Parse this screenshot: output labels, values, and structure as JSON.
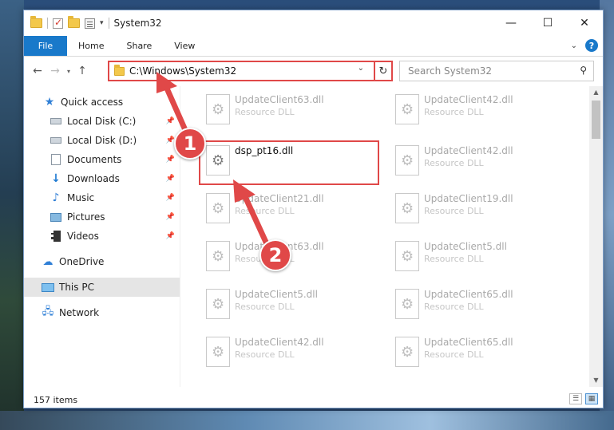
{
  "window": {
    "title": "System32"
  },
  "ribbon": {
    "tabs": [
      "File",
      "Home",
      "Share",
      "View"
    ]
  },
  "address": {
    "path": "C:\\Windows\\System32"
  },
  "search": {
    "placeholder": "Search System32"
  },
  "sidebar": {
    "items": [
      {
        "label": "Quick access",
        "icon": "star-icon"
      },
      {
        "label": "Local Disk (C:)",
        "icon": "drive-icon",
        "pinned": true
      },
      {
        "label": "Local Disk (D:)",
        "icon": "drive-icon",
        "pinned": true
      },
      {
        "label": "Documents",
        "icon": "documents-icon",
        "pinned": true
      },
      {
        "label": "Downloads",
        "icon": "download-icon",
        "pinned": true
      },
      {
        "label": "Music",
        "icon": "music-icon",
        "pinned": true
      },
      {
        "label": "Pictures",
        "icon": "pictures-icon",
        "pinned": true
      },
      {
        "label": "Videos",
        "icon": "videos-icon",
        "pinned": true
      },
      {
        "label": "OneDrive",
        "icon": "cloud-icon"
      },
      {
        "label": "This PC",
        "icon": "computer-icon",
        "selected": true
      },
      {
        "label": "Network",
        "icon": "network-icon"
      }
    ]
  },
  "files": [
    {
      "name": "UpdateClient63.dll",
      "type": "Resource DLL"
    },
    {
      "name": "UpdateClient42.dll",
      "type": "Resource DLL"
    },
    {
      "name": "dsp_pt16.dll",
      "type": "",
      "selected": true
    },
    {
      "name": "UpdateClient42.dll",
      "type": "Resource DLL"
    },
    {
      "name": "UpdateClient21.dll",
      "type": "Resource DLL"
    },
    {
      "name": "UpdateClient19.dll",
      "type": "Resource DLL"
    },
    {
      "name": "UpdateClient63.dll",
      "type": "Resource DLL"
    },
    {
      "name": "UpdateClient5.dll",
      "type": "Resource DLL"
    },
    {
      "name": "UpdateClient5.dll",
      "type": "Resource DLL"
    },
    {
      "name": "UpdateClient65.dll",
      "type": "Resource DLL"
    },
    {
      "name": "UpdateClient42.dll",
      "type": "Resource DLL"
    },
    {
      "name": "UpdateClient65.dll",
      "type": "Resource DLL"
    }
  ],
  "status": {
    "item_count": "157 items"
  },
  "annotations": {
    "badge1": "1",
    "badge2": "2",
    "color": "#e04848"
  }
}
